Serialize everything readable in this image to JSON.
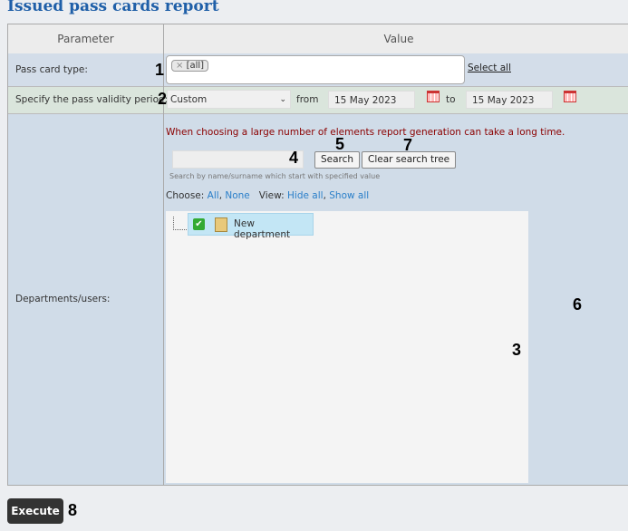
{
  "title": "Issued pass cards report",
  "header": {
    "parameter": "Parameter",
    "value": "Value"
  },
  "pass_card_type": {
    "label": "Pass card type:",
    "tag": "[all]",
    "tag_remove": "×",
    "select_all": "Select all"
  },
  "validity": {
    "label": "Specify the pass validity period:",
    "selected": "Custom",
    "from_label": "from",
    "from": "15 May 2023",
    "to_label": "to",
    "to": "15 May 2023"
  },
  "departments": {
    "label": "Departments/users:",
    "warning": "When choosing a large number of elements report generation can take a long time.",
    "search_value": "",
    "search_button": "Search",
    "clear_button": "Clear search tree",
    "hint": "Search by name/surname which start with specified value",
    "choose_label": "Choose:",
    "all": "All",
    "none": "None",
    "view_label": "View:",
    "hide_all": "Hide all",
    "show_all": "Show all",
    "tree": [
      {
        "label": "New department",
        "checked": true
      }
    ]
  },
  "execute": "Execute",
  "annotations": [
    "1",
    "2",
    "3",
    "4",
    "5",
    "6",
    "7",
    "8"
  ]
}
